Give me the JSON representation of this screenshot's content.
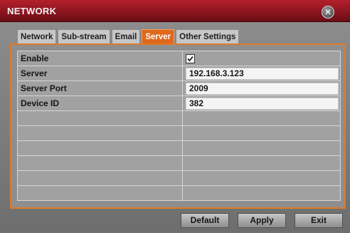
{
  "window": {
    "title": "NETWORK"
  },
  "tabs": [
    {
      "label": "Network",
      "active": false
    },
    {
      "label": "Sub-stream",
      "active": false
    },
    {
      "label": "Email",
      "active": false
    },
    {
      "label": "Server",
      "active": true
    },
    {
      "label": "Other Settings",
      "active": false
    }
  ],
  "form": {
    "enable_label": "Enable",
    "enable_checked": true,
    "server_label": "Server",
    "server_value": "192.168.3.123",
    "port_label": "Server Port",
    "port_value": "2009",
    "device_id_label": "Device ID",
    "device_id_value": "382"
  },
  "buttons": {
    "default": "Default",
    "apply": "Apply",
    "exit": "Exit"
  },
  "colors": {
    "accent": "#e0671b",
    "titlebar": "#8c1420"
  }
}
